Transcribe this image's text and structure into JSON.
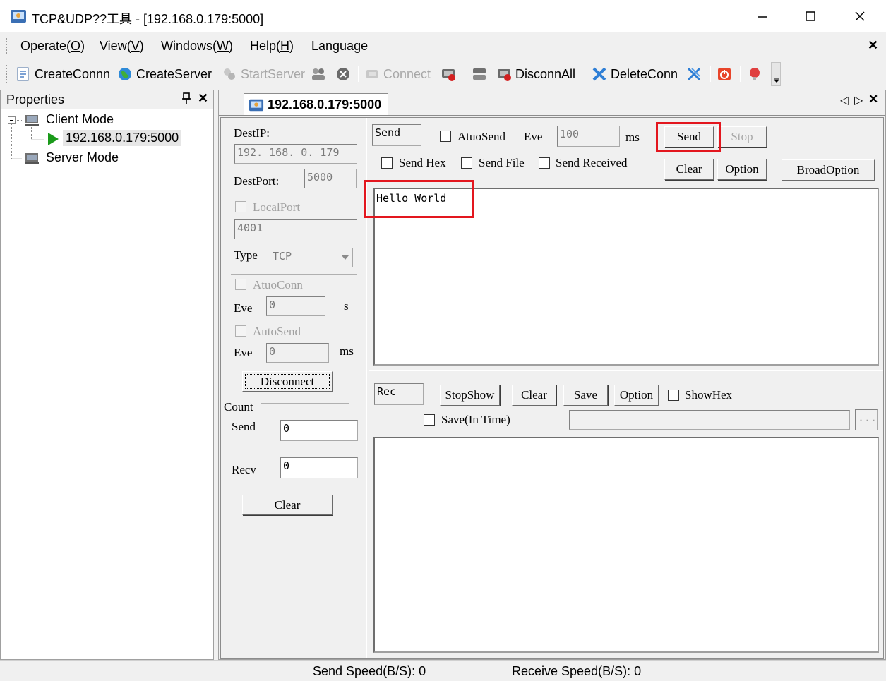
{
  "window": {
    "title": "TCP&UDP??工具 - [192.168.0.179:5000]",
    "minimize": "—",
    "maximize": "☐",
    "close": "✕"
  },
  "menu": {
    "operate": "Operate(",
    "operate_key": "O",
    "operate_end": ")",
    "view": "View(",
    "view_key": "V",
    "view_end": ")",
    "windows": "Windows(",
    "windows_key": "W",
    "windows_end": ")",
    "help": "Help(",
    "help_key": "H",
    "help_end": ")",
    "language": "Language",
    "close": "✕"
  },
  "toolbar": {
    "create_conn": "CreateConnn",
    "create_server": "CreateServer",
    "start_server": "StartServer",
    "connect": "Connect",
    "disconn_all": "DisconnAll",
    "delete_conn": "DeleteConn"
  },
  "properties": {
    "title": "Properties",
    "pin": "ᵱ",
    "close": "✕",
    "tree": {
      "client_mode": "Client Mode",
      "connection": "192.168.0.179:5000",
      "server_mode": "Server Mode"
    }
  },
  "doc": {
    "tab_label": "192.168.0.179:5000",
    "nav_left": "◁",
    "nav_right": "▷",
    "close": "✕"
  },
  "settings": {
    "dest_ip_label": "DestIP:",
    "dest_ip": "192. 168. 0. 179",
    "dest_port_label": "DestPort:",
    "dest_port": "5000",
    "local_port_label": "LocalPort",
    "local_port": "4001",
    "type_label": "Type",
    "type_value": "TCP",
    "auto_conn_label": "AtuoConn",
    "eve_label": "Eve",
    "auto_conn_interval": "0",
    "auto_conn_unit": "s",
    "auto_send_label": "AutoSend",
    "auto_send_interval": "0",
    "auto_send_unit": "ms",
    "disconnect_button": "Disconnect",
    "count_label": "Count",
    "send_count_label": "Send",
    "send_count": "0",
    "recv_count_label": "Recv",
    "recv_count": "0",
    "clear_button": "Clear"
  },
  "send_panel": {
    "mode_box": "Send",
    "auto_send_label": "AtuoSend",
    "eve_label": "Eve",
    "interval": "100",
    "unit": "ms",
    "send_button": "Send",
    "stop_button": "Stop",
    "send_hex": "Send Hex",
    "send_file": "Send File",
    "send_received": "Send Received",
    "clear_button": "Clear",
    "option_button": "Option",
    "broad_option_button": "BroadOption",
    "text": "Hello World"
  },
  "recv_panel": {
    "mode_box": "Rec",
    "stop_show_button": "StopShow",
    "clear_button": "Clear",
    "save_button": "Save",
    "option_button": "Option",
    "show_hex": "ShowHex",
    "save_in_time": "Save(In Time)",
    "browse_button": "...",
    "path": ""
  },
  "status": {
    "send_speed": "Send Speed(B/S): 0",
    "receive_speed": "Receive Speed(B/S): 0"
  },
  "colors": {
    "highlight": "#e3161e",
    "play_green": "#1a9a1a"
  }
}
